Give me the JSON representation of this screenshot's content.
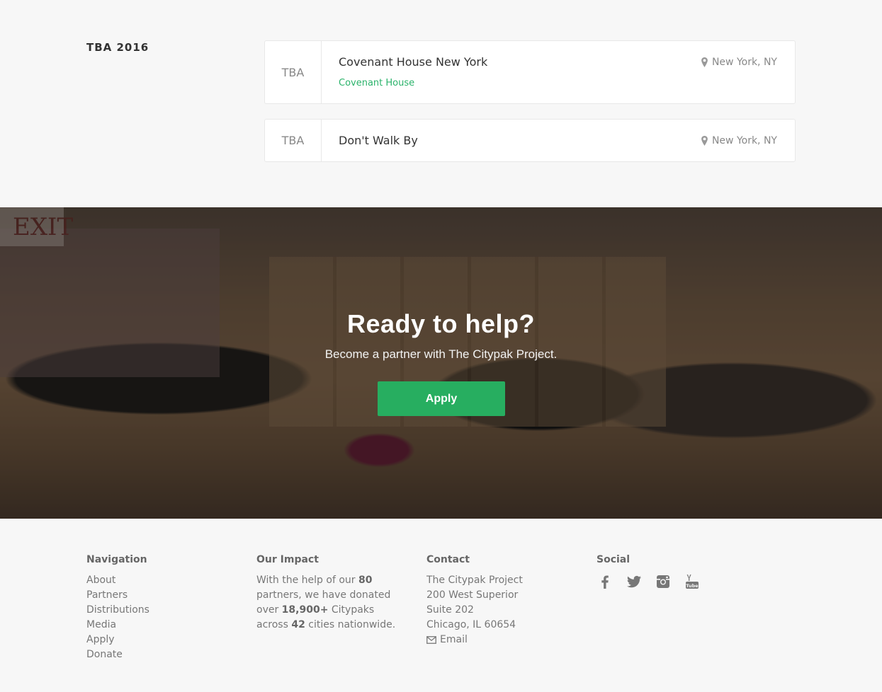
{
  "schedule": {
    "year_label": "TBA 2016",
    "events": [
      {
        "date": "TBA",
        "title": "Covenant House New York",
        "org": "Covenant House",
        "location": "New York, NY"
      },
      {
        "date": "TBA",
        "title": "Don't Walk By",
        "location": "New York, NY"
      }
    ]
  },
  "hero": {
    "sign_text": "EXIT",
    "title": "Ready to help?",
    "subtitle": "Become a partner with The Citypak Project.",
    "apply_label": "Apply"
  },
  "footer": {
    "navigation": {
      "heading": "Navigation",
      "links": [
        "About",
        "Partners",
        "Distributions",
        "Media",
        "Apply",
        "Donate"
      ]
    },
    "impact": {
      "heading": "Our Impact",
      "text_1": "With the help of our ",
      "partners_count": "80",
      "text_2": " partners, we have donated over ",
      "citypaks_count": "18,900+",
      "text_3": " Citypaks across ",
      "cities_count": "42",
      "text_4": " cities nationwide."
    },
    "contact": {
      "heading": "Contact",
      "name": "The Citypak Project",
      "address_1": "200 West Superior",
      "address_2": "Suite 202",
      "city": "Chicago, IL 60654",
      "email_label": "Email"
    },
    "social": {
      "heading": "Social",
      "icons": [
        "facebook-icon",
        "twitter-icon",
        "instagram-icon",
        "youtube-icon"
      ]
    }
  },
  "colors": {
    "accent_green": "#27ae60",
    "org_link_green": "#2bb36b",
    "background": "#f7f7f7"
  }
}
